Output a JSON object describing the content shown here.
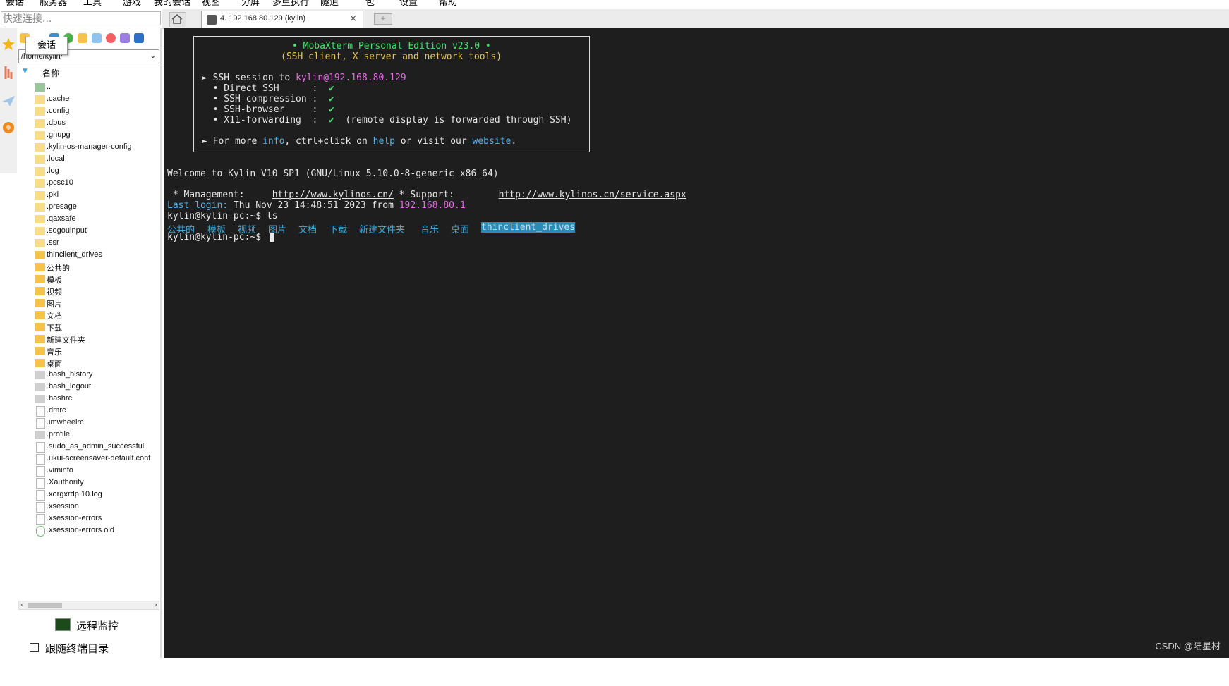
{
  "menubar": [
    "会话",
    "服务器",
    "工具",
    "游戏",
    "我的会话",
    "视图",
    "分屏",
    "多重执行",
    "隧道",
    "包",
    "设置",
    "帮助"
  ],
  "quick_connect_placeholder": "快速连接...",
  "tab": {
    "title": "4. 192.168.80.129 (kylin)",
    "close": "×"
  },
  "tooltip": "会话",
  "sftp": {
    "path": "/home/kylin/",
    "column_header": "名称",
    "files": [
      {
        "name": "..",
        "type": "folder-up"
      },
      {
        "name": ".cache",
        "type": "folder-light"
      },
      {
        "name": ".config",
        "type": "folder-light"
      },
      {
        "name": ".dbus",
        "type": "folder-light"
      },
      {
        "name": ".gnupg",
        "type": "folder-light"
      },
      {
        "name": ".kylin-os-manager-config",
        "type": "folder-light"
      },
      {
        "name": ".local",
        "type": "folder-light"
      },
      {
        "name": ".log",
        "type": "folder-light"
      },
      {
        "name": ".pcsc10",
        "type": "folder-light"
      },
      {
        "name": ".pki",
        "type": "folder-light"
      },
      {
        "name": ".presage",
        "type": "folder-light"
      },
      {
        "name": ".qaxsafe",
        "type": "folder-light"
      },
      {
        "name": ".sogouinput",
        "type": "folder-light"
      },
      {
        "name": ".ssr",
        "type": "folder-light"
      },
      {
        "name": "thinclient_drives",
        "type": "folder"
      },
      {
        "name": "公共的",
        "type": "folder"
      },
      {
        "name": "模板",
        "type": "folder"
      },
      {
        "name": "视频",
        "type": "folder"
      },
      {
        "name": "图片",
        "type": "folder"
      },
      {
        "name": "文档",
        "type": "folder"
      },
      {
        "name": "下载",
        "type": "folder"
      },
      {
        "name": "新建文件夹",
        "type": "folder"
      },
      {
        "name": "音乐",
        "type": "folder"
      },
      {
        "name": "桌面",
        "type": "folder"
      },
      {
        "name": ".bash_history",
        "type": "file-gray"
      },
      {
        "name": ".bash_logout",
        "type": "file-gray"
      },
      {
        "name": ".bashrc",
        "type": "file-gray"
      },
      {
        "name": ".dmrc",
        "type": "file-doc"
      },
      {
        "name": ".imwheelrc",
        "type": "file-doc"
      },
      {
        "name": ".profile",
        "type": "file-gray"
      },
      {
        "name": ".sudo_as_admin_successful",
        "type": "file-doc"
      },
      {
        "name": ".ukui-screensaver-default.conf",
        "type": "file-doc"
      },
      {
        "name": ".viminfo",
        "type": "file-doc"
      },
      {
        "name": ".Xauthority",
        "type": "file-doc"
      },
      {
        "name": ".xorgxrdp.10.log",
        "type": "file-doc"
      },
      {
        "name": ".xsession",
        "type": "file-doc"
      },
      {
        "name": ".xsession-errors",
        "type": "file-doc"
      },
      {
        "name": ".xsession-errors.old",
        "type": "file-green"
      }
    ],
    "remote_monitor_label": "远程监控",
    "follow_terminal_label": "跟随终端目录"
  },
  "terminal": {
    "banner_title": "• MobaXterm Personal Edition v23.0 •",
    "banner_subtitle": "(SSH client, X server and network tools)",
    "session_prefix": "► SSH session to ",
    "session_target": "kylin@192.168.80.129",
    "direct_ssh": "  • Direct SSH      :  ",
    "ssh_compression": "  • SSH compression :  ",
    "ssh_browser": "  • SSH-browser     :  ",
    "x11_forwarding": "  • X11-forwarding  :  ",
    "check": "✔",
    "x11_note": "  (remote display is forwarded through SSH)",
    "more_prefix": "► For more ",
    "more_info": "info",
    "more_mid": ", ctrl+click on ",
    "more_help": "help",
    "more_or": " or visit our ",
    "more_website": "website",
    "more_end": ".",
    "welcome": "Welcome to Kylin V10 SP1 (GNU/Linux 5.10.0-8-generic x86_64)",
    "management_label": " * Management:     ",
    "management_url": "http://www.kylinos.cn/",
    "support_label": " * Support:        ",
    "support_url": "http://www.kylinos.cn/service.aspx",
    "last_login_label": "Last login:",
    "last_login_value": " Thu Nov 23 14:48:51 2023 from ",
    "last_login_ip": "192.168.80.1",
    "prompt1": "kylin@kylin-pc:~$ ls",
    "ls_items": [
      "公共的",
      "模板",
      "视频",
      "图片",
      "文档",
      "下载",
      "新建文件夹",
      "音乐",
      "桌面"
    ],
    "ls_highlight": "thinclient_drives",
    "prompt2": "kylin@kylin-pc:~$ "
  },
  "watermark": "CSDN @陆星材"
}
